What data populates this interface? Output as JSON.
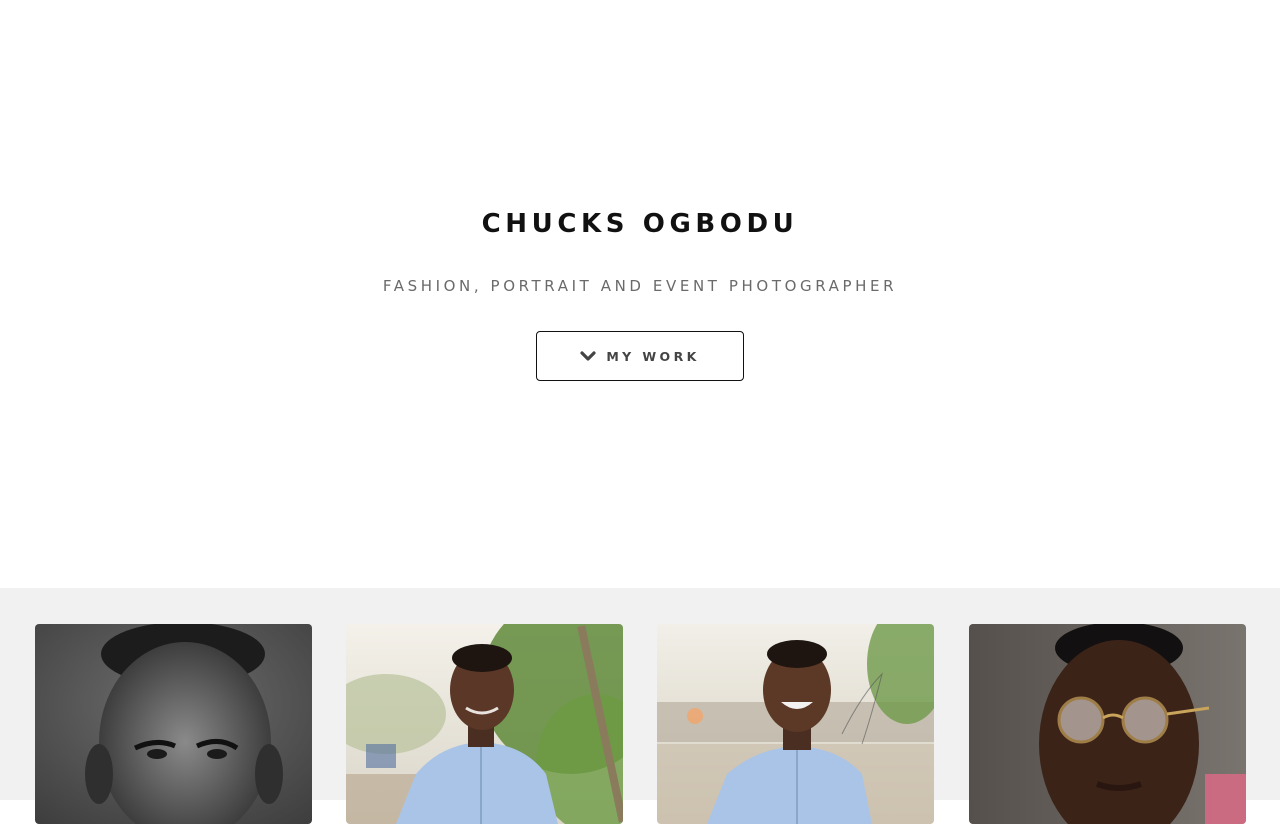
{
  "hero": {
    "title": "CHUCKS OGBODU",
    "subtitle": "FASHION, PORTRAIT AND EVENT PHOTOGRAPHER",
    "cta_label": "MY WORK",
    "cta_icon": "chevron-down-icon"
  },
  "gallery": {
    "background": "#f1f1f1",
    "photos": [
      {
        "subject": "black-and-white portrait"
      },
      {
        "subject": "portrait outdoors in light blue shirt"
      },
      {
        "subject": "smiling portrait outdoors in light blue shirt"
      },
      {
        "subject": "portrait with round glasses"
      }
    ]
  },
  "colors": {
    "title": "#111111",
    "subtitle": "#6a6a6a",
    "button_border": "#111111",
    "button_text": "#444444"
  }
}
